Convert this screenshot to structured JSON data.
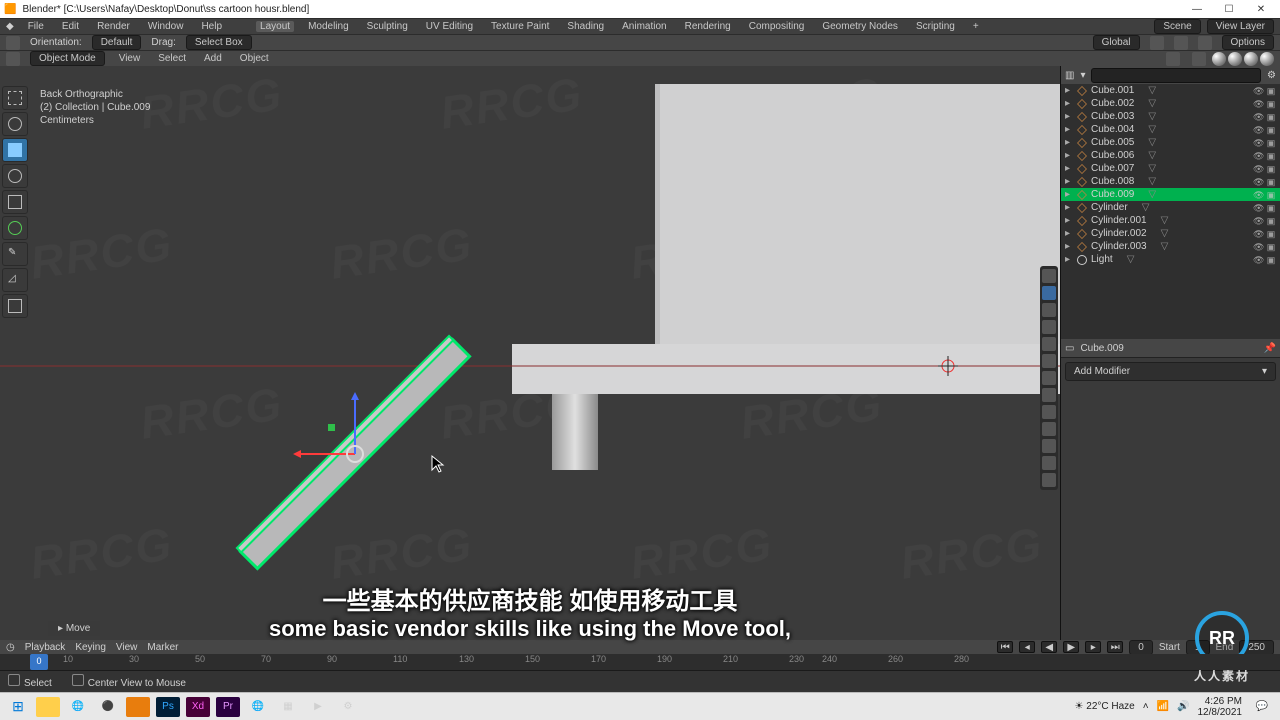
{
  "window": {
    "title": "Blender* [C:\\Users\\Nafay\\Desktop\\Donut\\ss cartoon housr.blend]"
  },
  "menubar": {
    "items": [
      "File",
      "Edit",
      "Render",
      "Window",
      "Help"
    ],
    "tabs": [
      "Layout",
      "Modeling",
      "Sculpting",
      "UV Editing",
      "Texture Paint",
      "Shading",
      "Animation",
      "Rendering",
      "Compositing",
      "Geometry Nodes",
      "Scripting",
      "+"
    ],
    "active_tab": "Layout",
    "scene_label": "Scene",
    "viewlayer_label": "View Layer"
  },
  "toolrow": {
    "orientation_label": "Orientation:",
    "orientation_value": "Default",
    "drag_label": "Drag:",
    "drag_value": "Select Box",
    "transform_label": "Global",
    "options_label": "Options"
  },
  "mode_row": {
    "mode": "Object Mode",
    "menus": [
      "View",
      "Select",
      "Add",
      "Object"
    ]
  },
  "overlay_text": {
    "line1": "Back Orthographic",
    "line2": "(2) Collection | Cube.009",
    "line3": "Centimeters"
  },
  "toolbar": {
    "items": [
      "select-box",
      "cursor",
      "move",
      "rotate",
      "scale",
      "transform",
      "annotate",
      "measure",
      "add-cube"
    ],
    "active": "move"
  },
  "outliner": {
    "filter_placeholder": "",
    "items": [
      {
        "name": "Cube.001"
      },
      {
        "name": "Cube.002"
      },
      {
        "name": "Cube.003"
      },
      {
        "name": "Cube.004"
      },
      {
        "name": "Cube.005"
      },
      {
        "name": "Cube.006"
      },
      {
        "name": "Cube.007"
      },
      {
        "name": "Cube.008"
      },
      {
        "name": "Cube.009",
        "sel": true
      },
      {
        "name": "Cylinder"
      },
      {
        "name": "Cylinder.001"
      },
      {
        "name": "Cylinder.002"
      },
      {
        "name": "Cylinder.003"
      },
      {
        "name": "Light",
        "type": "light"
      }
    ]
  },
  "properties": {
    "header": "Cube.009",
    "add_modifier": "Add Modifier"
  },
  "move_chip": "Move",
  "timeline": {
    "menus": [
      "Playback",
      "Keying",
      "View",
      "Marker"
    ],
    "start_label": "Start",
    "start": 1,
    "end_label": "End",
    "end": 250,
    "current": 0,
    "ticks": [
      10,
      30,
      50,
      70,
      90,
      110,
      130,
      150,
      170,
      190,
      210,
      230,
      240,
      260,
      280
    ]
  },
  "statusbar": {
    "left": "Select",
    "center": "Center View to Mouse"
  },
  "subtitles": {
    "zh": "一些基本的供应商技能 如使用移动工具",
    "en": "some basic vendor skills like using the Move tool,"
  },
  "taskbar": {
    "weather": "22°C Haze",
    "time": "4:26 PM",
    "date": "12/8/2021"
  },
  "watermark": "RRCG",
  "logo_text": "人人素材",
  "chart_data": null
}
